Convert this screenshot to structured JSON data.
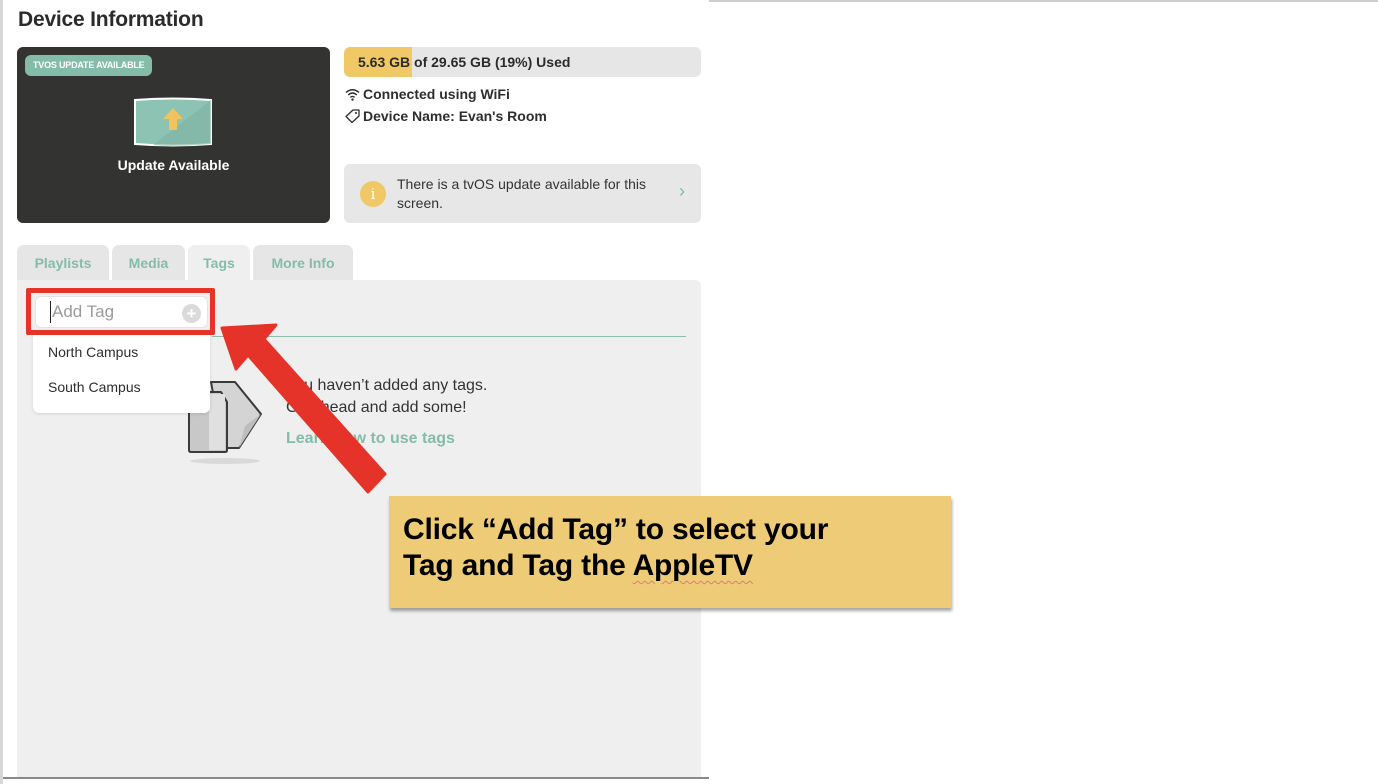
{
  "page": {
    "title": "Device Information"
  },
  "device_card": {
    "badge": "TVOS UPDATE AVAILABLE",
    "icon": "screen-update-icon",
    "label": "Update Available"
  },
  "storage": {
    "text": "5.63 GB of 29.65 GB (19%) Used",
    "used_gb": 5.63,
    "total_gb": 29.65,
    "used_percent": 19,
    "fill_color": "#f0c966"
  },
  "info": {
    "connection": "Connected using WiFi",
    "connection_icon": "wifi-icon",
    "device_name": "Device Name: Evan's Room",
    "device_name_icon": "tag-icon"
  },
  "notice": {
    "icon": "info-icon",
    "icon_glyph": "i",
    "text": "There is a tvOS update available for this screen.",
    "chevron": "›"
  },
  "tabs": [
    {
      "label": "Playlists",
      "active": false
    },
    {
      "label": "Media",
      "active": false
    },
    {
      "label": "Tags",
      "active": true
    },
    {
      "label": "More Info",
      "active": false
    }
  ],
  "tags_panel": {
    "input_placeholder": "Add Tag",
    "input_value": "",
    "add_glyph": "+",
    "dropdown_options": [
      "North Campus",
      "South Campus"
    ],
    "empty_line1": "You haven’t added any tags.",
    "empty_line2": "Go ahead and add some!",
    "learn_link": "Learn how to use tags"
  },
  "annotation": {
    "callout_line1": "Click “Add Tag” to select your",
    "callout_line2_prefix": "Tag and Tag the ",
    "callout_line2_word": "AppleTV",
    "highlight_color": "#e5332a",
    "callout_color": "#eecb77"
  },
  "colors": {
    "accent_teal": "#84bcaa",
    "dark_card": "#333432",
    "panel_bg": "#efefef"
  }
}
